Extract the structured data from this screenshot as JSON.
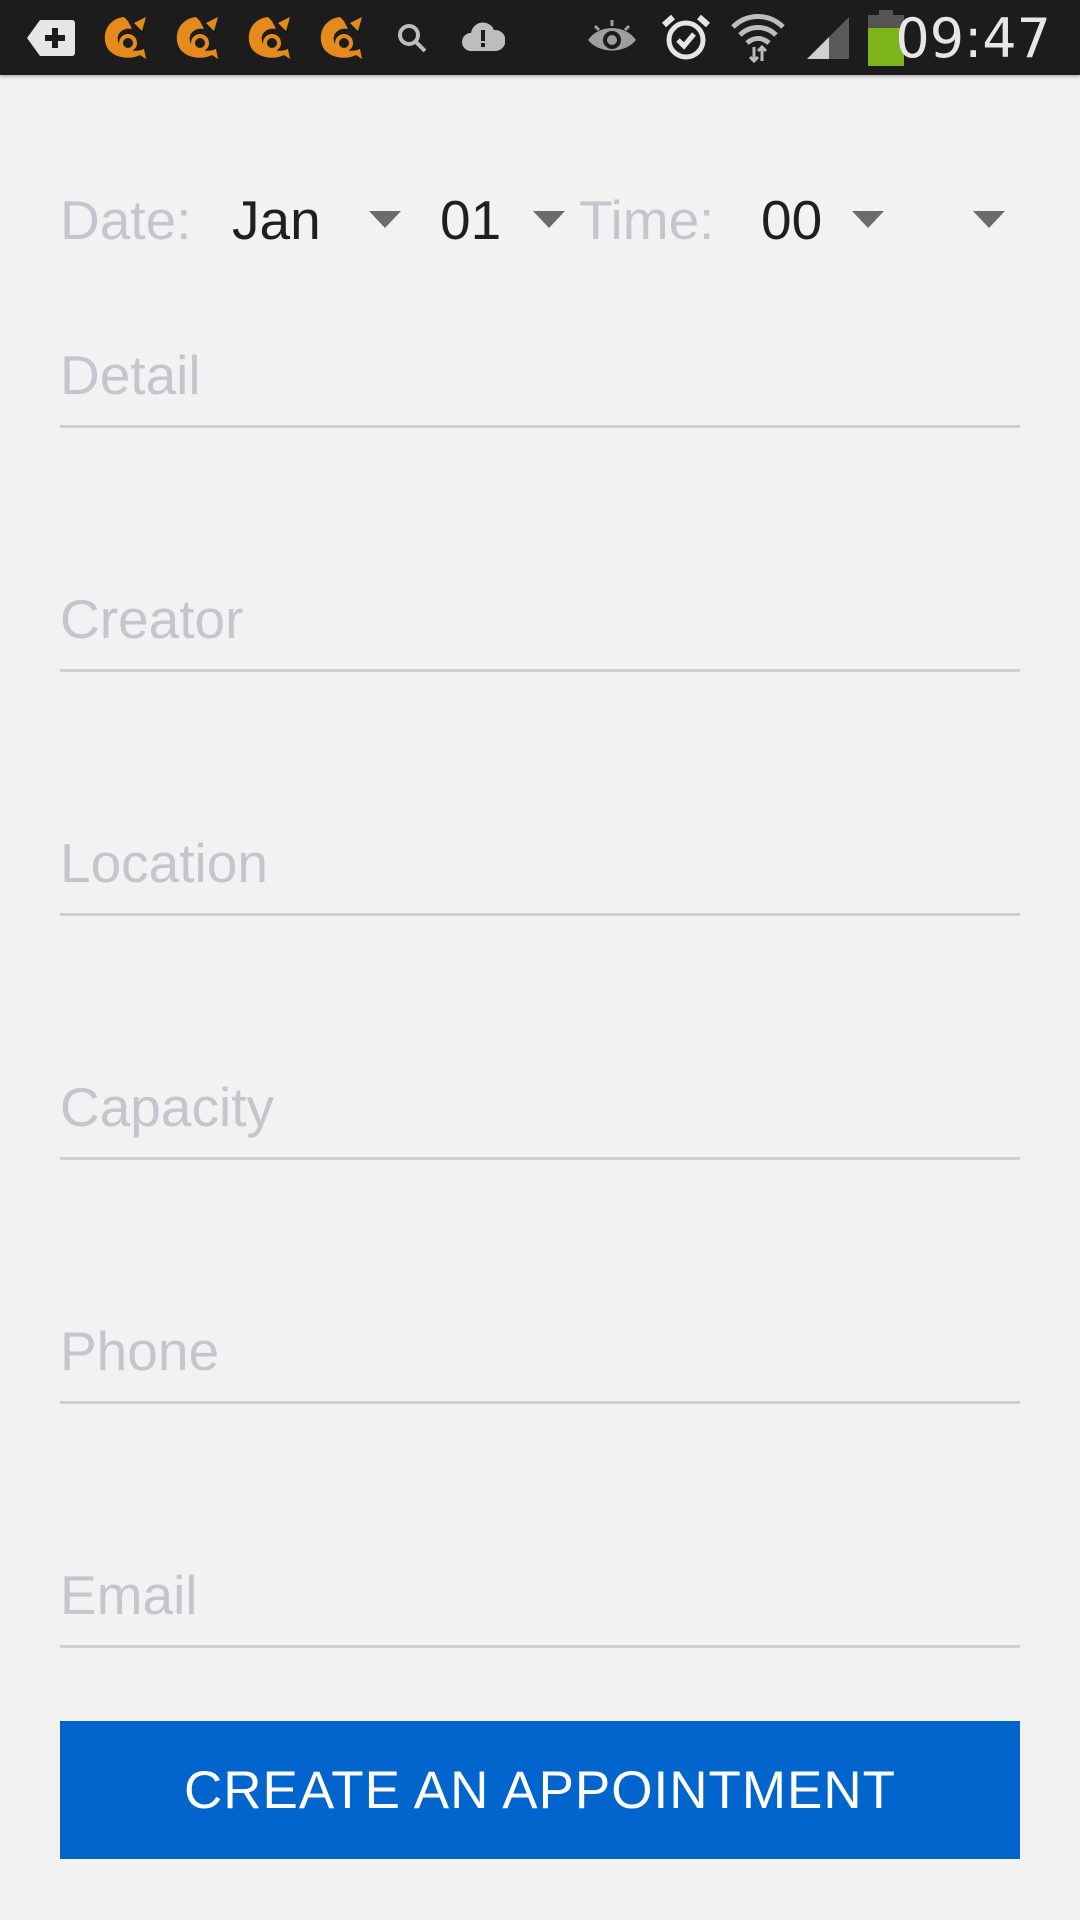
{
  "status_bar": {
    "time": "09:47",
    "icons": [
      "add-box-icon",
      "uc-browser-icon",
      "uc-browser-icon",
      "uc-browser-icon",
      "uc-browser-icon",
      "search-icon",
      "cloud-alert-icon",
      "eye-icon",
      "alarm-clock-icon",
      "wifi-icon",
      "cellular-signal-icon",
      "battery-icon"
    ],
    "accent_colors": {
      "uc_icon": "#e58a1c",
      "battery": "#7cb41a"
    }
  },
  "datetime": {
    "date_label": "Date:",
    "month_value": "Jan",
    "day_value": "01",
    "time_label": "Time:",
    "hour_value": "00",
    "minute_value": ""
  },
  "form": {
    "detail_placeholder": "Detail",
    "creator_placeholder": "Creator",
    "location_placeholder": "Location",
    "capacity_placeholder": "Capacity",
    "phone_placeholder": "Phone",
    "email_placeholder": "Email"
  },
  "actions": {
    "create_label": "CREATE AN APPOINTMENT",
    "button_color": "#0265cd"
  }
}
